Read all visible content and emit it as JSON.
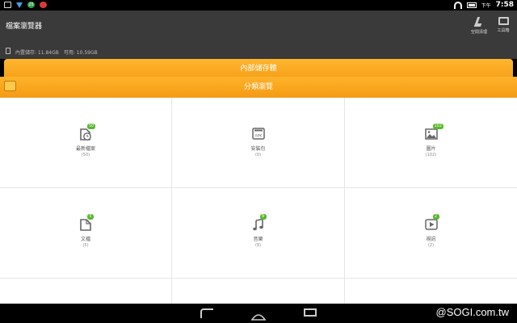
{
  "status_bar": {
    "notif_badge": "25",
    "time_prefix": "下午",
    "time": "7:58"
  },
  "app_bar": {
    "title": "檔案瀏覽器",
    "actions": [
      {
        "label": "空間清理",
        "icon": "broom-icon"
      },
      {
        "label": "工具箱",
        "icon": "toolbox-icon"
      }
    ],
    "storage": {
      "internal_label": "內置儲存: 11.84GB",
      "available_label": "可用: 10.59GB"
    }
  },
  "tabs": {
    "internal": "內部儲存體",
    "category": "分類瀏覽"
  },
  "categories": [
    {
      "label": "最新檔案",
      "count": "(50)",
      "badge": "50",
      "icon": "recent-file-icon"
    },
    {
      "label": "安裝包",
      "count": "(0)",
      "badge": "",
      "icon": "apk-icon",
      "icon_text": "APK"
    },
    {
      "label": "圖片",
      "count": "(102)",
      "badge": "102",
      "icon": "image-icon"
    },
    {
      "label": "文檔",
      "count": "(5)",
      "badge": "5",
      "icon": "document-icon"
    },
    {
      "label": "音樂",
      "count": "(9)",
      "badge": "9",
      "icon": "music-icon"
    },
    {
      "label": "視訊",
      "count": "(2)",
      "badge": "2",
      "icon": "video-icon"
    }
  ],
  "watermark": "@SOGI.com.tw",
  "colors": {
    "accent": "#f6a11a",
    "badge": "#57b82b",
    "appbar": "#3a3a3a"
  }
}
